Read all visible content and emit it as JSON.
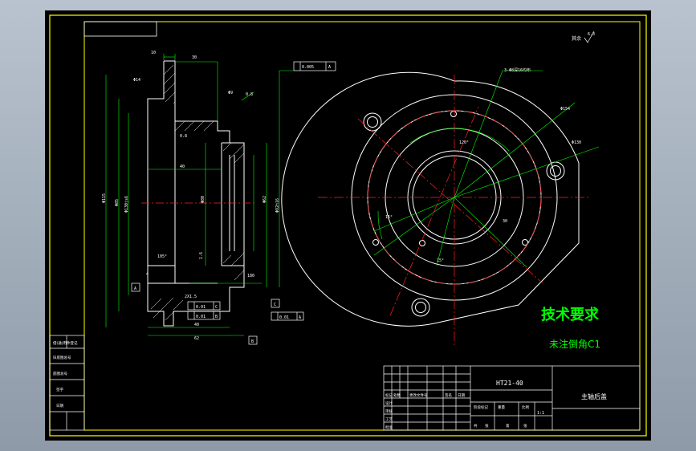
{
  "colors": {
    "outline": "#ffffff",
    "frame": "#ffff00",
    "dimension": "#00ff00",
    "center_line": "#ff2020",
    "viewport_bg": "#000000",
    "window_bg": "#a8b3c0"
  },
  "section_view": {
    "dims_top": [
      "10",
      "30"
    ],
    "dim_left_top": "Φ14",
    "dim_chamfer": "Φ9",
    "dim_angle": "0.8",
    "dims_vertical": [
      "Φ115",
      "Φ85",
      "Φ130js6",
      "Φ80",
      "Φ62",
      "Φ92h16"
    ],
    "dim_40": "40",
    "dim_ref": "1.6",
    "dim_105": "105°",
    "dim_4": "4",
    "dim_180": "180",
    "dim_2x1_5": "2X1.5",
    "dim_40b": "40",
    "dim_62b": "62",
    "tolerance_top": "0.005",
    "tolerance_top_datum": "A",
    "tolerance_1_val": "0.01",
    "tolerance_1_datum": "C",
    "tolerance_2_val": "0.01",
    "tolerance_2_datum": "B",
    "tolerance_3_val": "0.01",
    "tolerance_3_datum": "A",
    "datum_a": "A",
    "datum_b": "B",
    "datum_c": "C",
    "roughness_top": "0.8"
  },
  "front_view": {
    "callout_holes": "3-Φ8深16均布",
    "dim_154": "Φ154",
    "dim_130": "Φ130",
    "angle_120": "120°",
    "angle_15": "15°",
    "angle_15b": "15°",
    "angle_30": "30"
  },
  "roughness_corner": {
    "label": "其余",
    "value": "6.3"
  },
  "technical_requirements": {
    "heading": "技术要求",
    "item": "未注倒角C1"
  },
  "title_block": {
    "material": "HT21-40",
    "part_name": "主轴后盖",
    "scale": "1:1",
    "headers": [
      "标记",
      "处数",
      "更改文件号",
      "签名",
      "日期"
    ],
    "row_labels": [
      "设计",
      "审核",
      "工艺",
      "批准"
    ],
    "cells": [
      "阶段标记",
      "重量",
      "比例",
      "共",
      "张",
      "第",
      "张"
    ]
  },
  "left_strip": {
    "labels": [
      "借(通)用件登记",
      "旧底图总号",
      "底图总号",
      "签字",
      "日期"
    ]
  }
}
